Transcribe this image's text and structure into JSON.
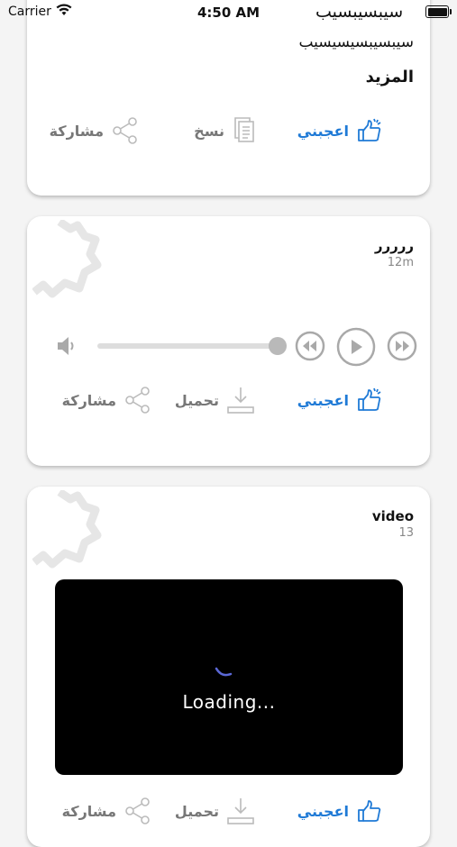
{
  "status_bar": {
    "carrier": "Carrier",
    "time": "4:50 AM",
    "header_title": "سيبسيبسيب"
  },
  "posts": [
    {
      "text": "سيبسيبسيسيسيب",
      "more_label": "المزيد",
      "actions": {
        "like": "اعجبني",
        "copy": "نسخ",
        "share": "مشاركة"
      }
    },
    {
      "name": "ررررر",
      "time": "12m",
      "audio": {
        "progress": 1.0
      },
      "actions": {
        "like": "اعجبني",
        "download": "تحميل",
        "share": "مشاركة"
      }
    },
    {
      "name": "video",
      "time": "13",
      "video": {
        "loading_text": "Loading..."
      },
      "actions": {
        "like": "اعجبني",
        "download": "تحميل",
        "share": "مشاركة"
      }
    }
  ],
  "colors": {
    "accent": "#1f7ad6",
    "muted": "#777777",
    "card_bg": "#ffffff",
    "page_bg": "#f4f4f4"
  }
}
